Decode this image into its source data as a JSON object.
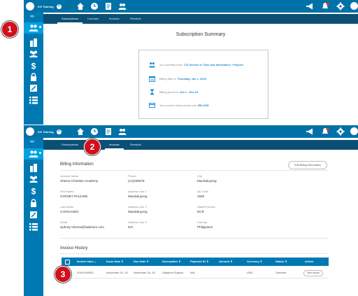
{
  "app": {
    "brand": "KG Training"
  },
  "colors": {
    "topbar": "#0072a8",
    "tabbar": "#0b4f75",
    "sidebar": "#0079b2",
    "accent_link": "#1a8ad0",
    "badge": "#d0101c"
  },
  "sidebar": {
    "expand_label": ">>"
  },
  "screen1": {
    "tabs": [
      "Subscriptions",
      "Licenses",
      "Invoices",
      "Receipts"
    ],
    "summary": {
      "title": "Subscription Summary",
      "rows": [
        {
          "icon": "users-icon",
          "prefix": "You currently have",
          "highlight": "173 license in Time and attendance + Payroll",
          "suffix": ""
        },
        {
          "icon": "calendar-icon",
          "prefix": "Billing date is",
          "highlight": "Thursday, Jan 1, 2026",
          "suffix": ""
        },
        {
          "icon": "hourglass-icon",
          "prefix": "Billing period is",
          "highlight": "Oct 1 - Dec 31",
          "suffix": ""
        },
        {
          "icon": "credit-card-icon",
          "prefix": "Your current setup would cost",
          "highlight": "996 USD",
          "suffix": ""
        }
      ]
    }
  },
  "screen2": {
    "tabs": [
      "Subscriptions",
      "Invoices",
      "Receipts"
    ],
    "billing": {
      "title": "Billing Information",
      "edit_label": "Edit Billing Information",
      "fields": {
        "account_name": {
          "label": "Account Name",
          "value": "Shema Christian Academy"
        },
        "phone": {
          "label": "Phone",
          "value": "(12)345678"
        },
        "city": {
          "label": "City",
          "value": "Mandaluyong"
        },
        "first_name": {
          "label": "First Name",
          "value": "SYDNEY PAULINE"
        },
        "address1": {
          "label": "Address Line 1",
          "value": "Mandaluyong"
        },
        "zip": {
          "label": "Zip Code",
          "value": "1550"
        },
        "last_name": {
          "label": "Last Name",
          "value": "CARGANDO"
        },
        "address2": {
          "label": "Address Line 2",
          "value": "Mandaluyong"
        },
        "state": {
          "label": "State/Province",
          "value": "NCR"
        },
        "email": {
          "label": "Email",
          "value": "sydney+shema@salarium.com"
        },
        "address3": {
          "label": "Address Line 3",
          "value": "N/A"
        },
        "country": {
          "label": "Country",
          "value": "Philippines"
        }
      }
    },
    "invoice_history": {
      "title": "Invoice History",
      "columns": [
        "Invoice Num ⌄",
        "Issue Date ⇕",
        "Due Date ⇕",
        "Description ⇕",
        "Payment Dt ⇕",
        "Amount ⇕",
        "Currency ⇕",
        "Status ⇕",
        "Action"
      ],
      "rows": [
        {
          "invoice_num": "2019-000003",
          "issue_date": "November 01, 20",
          "due_date": "November 15, 20",
          "description": "Salarium Subscri",
          "payment_dt": "N/A",
          "amount": "",
          "currency": "USD",
          "status": "Overdue",
          "action": "View Invoice"
        }
      ]
    }
  },
  "callouts": [
    "1",
    "2",
    "3"
  ]
}
